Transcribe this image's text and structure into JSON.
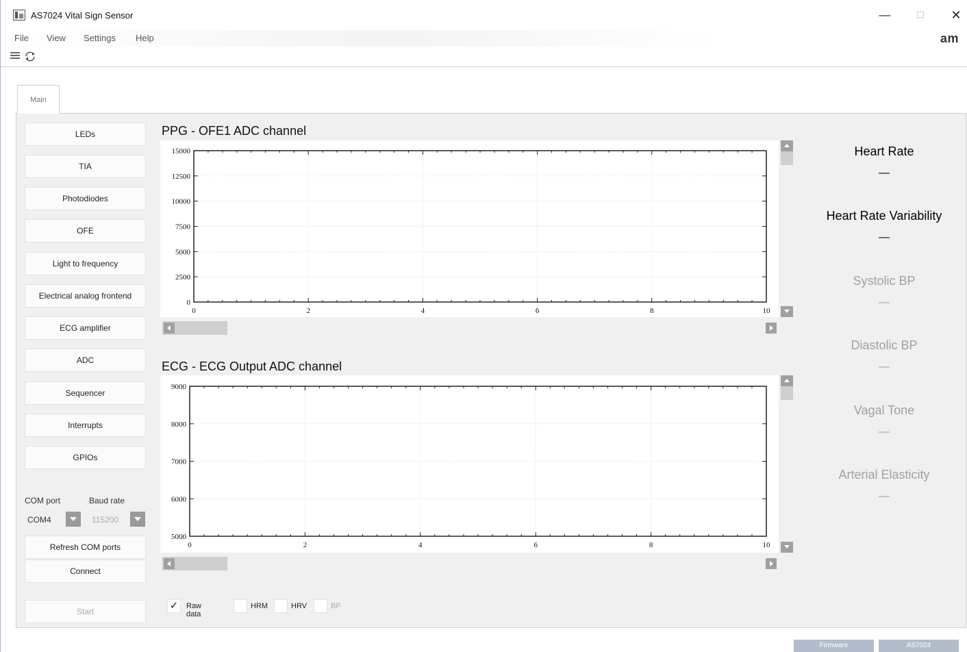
{
  "window": {
    "title": "AS7024 Vital Sign Sensor",
    "minimize_glyph": "—",
    "maximize_glyph": "☐",
    "close_glyph": "✕",
    "logo": "am"
  },
  "menu": [
    "File",
    "View",
    "Settings",
    "Help"
  ],
  "toolbar": {
    "icons": [
      "list-icon",
      "refresh-icon"
    ]
  },
  "tab": {
    "label": "Main"
  },
  "sidebar": {
    "buttons": [
      "LEDs",
      "TIA",
      "Photodiodes",
      "OFE",
      "Light to frequency",
      "Electrical analog frontend",
      "ECG amplifier",
      "ADC",
      "Sequencer",
      "Interrupts",
      "GPIOs"
    ],
    "com_port_label": "COM port",
    "baud_rate_label": "Baud rate",
    "com_port_value": "COM4",
    "baud_rate_value": "115200",
    "refresh_label": "Refresh COM ports",
    "connect_label": "Connect",
    "start_label": "Start"
  },
  "chart_data": [
    {
      "type": "line",
      "title": "PPG - OFE1 ADC channel",
      "xlim": [
        0,
        10
      ],
      "ylim": [
        0,
        15000
      ],
      "xticks": [
        0,
        2,
        4,
        6,
        8,
        10
      ],
      "yticks": [
        0,
        2500,
        5000,
        7500,
        10000,
        12500,
        15000
      ],
      "grid": true,
      "series": []
    },
    {
      "type": "line",
      "title": "ECG - ECG Output ADC channel",
      "xlim": [
        0,
        10
      ],
      "ylim": [
        5000,
        9000
      ],
      "xticks": [
        0,
        2,
        4,
        6,
        8,
        10
      ],
      "yticks": [
        5000,
        6000,
        7000,
        8000,
        9000
      ],
      "grid": true,
      "series": []
    }
  ],
  "metrics": [
    {
      "label": "Heart Rate",
      "value": "—",
      "color": "#111111"
    },
    {
      "label": "Heart Rate Variability",
      "value": "—",
      "color": "#111111"
    },
    {
      "label": "Systolic BP",
      "value": "—",
      "color": "#a0a0a0"
    },
    {
      "label": "Diastolic BP",
      "value": "—",
      "color": "#a0a0a0"
    },
    {
      "label": "Vagal Tone",
      "value": "—",
      "color": "#a0a0a0"
    },
    {
      "label": "Arterial Elasticity",
      "value": "—",
      "color": "#a0a0a0"
    }
  ],
  "checkboxes": [
    {
      "label": "Raw data",
      "checked": true
    },
    {
      "label": "HRM",
      "checked": false
    },
    {
      "label": "HRV",
      "checked": false
    },
    {
      "label": "BP",
      "checked": false
    }
  ],
  "footer": {
    "firmware_label": "Firmware",
    "device_label": "AS7024"
  }
}
